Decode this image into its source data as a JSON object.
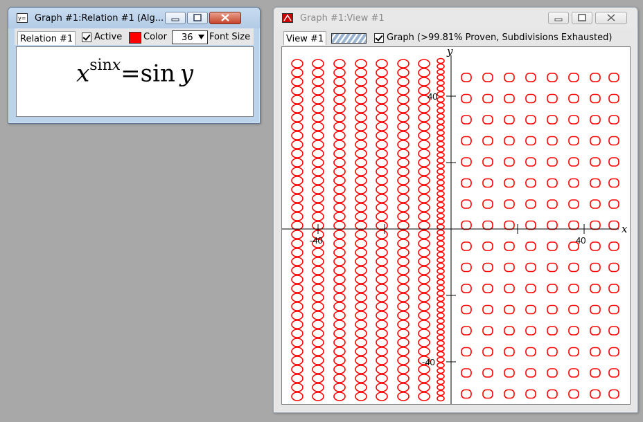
{
  "relation_window": {
    "title": "Graph #1:Relation #1 (Alg...",
    "tab_label": "Relation #1",
    "active_label": "Active",
    "active_checked": true,
    "color_label": "Color",
    "color_value": "#ff0000",
    "font_size_value": "36",
    "font_size_label": "Font Size",
    "formula": {
      "base": "x",
      "exponent_fn": "sin",
      "exponent_var": "x",
      "equals": "=",
      "rhs_fn": "sin",
      "rhs_var": "y"
    }
  },
  "view_window": {
    "title": "Graph #1:View #1",
    "tab_label": "View #1",
    "graph_checked": true,
    "graph_status": "Graph (>99.81% Proven, Subdivisions Exhausted)",
    "plot": {
      "x_axis_label": "x",
      "y_axis_label": "y",
      "x_tick_labels": [
        "-40",
        "40"
      ],
      "y_tick_labels": [
        "40",
        "-40"
      ],
      "curve_color": "#ff0000"
    }
  },
  "colors": {
    "desktop": "#a8a8a8",
    "curve": "#ff0000"
  }
}
